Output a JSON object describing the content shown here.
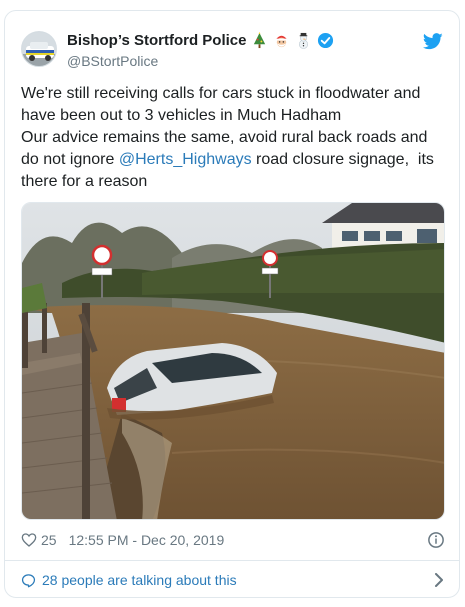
{
  "tweet": {
    "display_name": "Bishop’s Stortford Police",
    "handle": "@BStortPolice",
    "emojis": [
      "christmas-tree-icon",
      "santa-icon",
      "snowman-icon",
      "verified-badge-icon"
    ],
    "text_before": "We're still receiving calls for cars stuck in floodwater and have been out to 3 vehicles in Much Hadham\nOur advice remains the same, avoid rural back roads and do not ignore ",
    "mention": "@Herts_Highways",
    "text_after": " road closure signage,  its there for a reason",
    "likes": "25",
    "timestamp": "12:55 PM - Dec 20, 2019",
    "talking": "28 people are talking about this"
  },
  "colors": {
    "link": "#2b7bb9",
    "twitter_blue": "#1da1f2",
    "muted": "#697882",
    "border": "#e1e8ed"
  }
}
